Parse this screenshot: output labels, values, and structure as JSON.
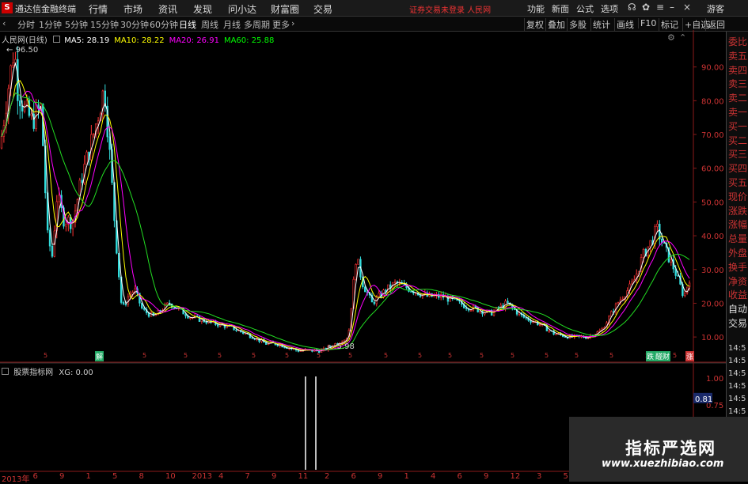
{
  "titlebar": {
    "logo": "S",
    "app_name": "通达信金融终端",
    "menus": [
      "行情",
      "市场",
      "资讯",
      "发现",
      "问小达",
      "财富圈",
      "交易"
    ],
    "broker_notice": "证券交易未登录  人民网",
    "right_menus": [
      "功能",
      "新面",
      "公式",
      "选项"
    ],
    "guest": "游客"
  },
  "toolbar": {
    "timeframes": [
      "分时",
      "1分钟",
      "5分钟",
      "15分钟",
      "30分钟",
      "60分钟",
      "日线",
      "周线",
      "月线",
      "多周期",
      "更多"
    ],
    "active": "日线",
    "right_tools": [
      "复权",
      "叠加",
      "多股",
      "统计",
      "画线",
      "F10",
      "标记",
      "+自选",
      "返回"
    ]
  },
  "main_chart": {
    "stock": "人民网(日线)",
    "ma": [
      {
        "name": "MA5",
        "value": "28.19",
        "color": "#ffffff"
      },
      {
        "name": "MA10",
        "value": "28.22",
        "color": "#ffff00"
      },
      {
        "name": "MA20",
        "value": "26.91",
        "color": "#ff00ff"
      },
      {
        "name": "MA60",
        "value": "25.88",
        "color": "#00ff00"
      }
    ],
    "high_label": "96.50",
    "low_label": "5.98",
    "y_ticks": [
      "90.00",
      "80.00",
      "70.00",
      "60.00",
      "50.00",
      "40.00",
      "30.00",
      "20.00",
      "10.00"
    ]
  },
  "sub_chart": {
    "title": "股票指标网",
    "xg": "XG: 0.00",
    "y_ticks": [
      "1.00",
      "0.75",
      "0.50",
      "0.25"
    ],
    "current": "0.81"
  },
  "right_panel": {
    "items": [
      "委比",
      "卖五",
      "卖四",
      "卖三",
      "卖二",
      "卖一",
      "买一",
      "买二",
      "买三",
      "买四",
      "买五",
      "现价",
      "涨跌",
      "涨幅",
      "总量",
      "外盘",
      "换手",
      "净资",
      "收益",
      "自动",
      "交易"
    ],
    "times": [
      "14:5",
      "14:5",
      "14:5",
      "14:5",
      "14:5",
      "14:5",
      "14:5",
      "14:5",
      "14:5",
      "14:5",
      "14:5"
    ]
  },
  "x_axis": [
    "2013年",
    "6",
    "9",
    "1",
    "5",
    "8",
    "10",
    "2013",
    "4",
    "7",
    "9",
    "11",
    "2",
    "6",
    "9",
    "1",
    "4",
    "6",
    "9",
    "12",
    "3",
    "5",
    "7",
    "10",
    "12",
    "3"
  ],
  "markers": [
    "解",
    "跌",
    "醛财",
    "涨"
  ],
  "watermark": {
    "title": "指标严选网",
    "url": "www.xuezhibiao.com"
  }
}
